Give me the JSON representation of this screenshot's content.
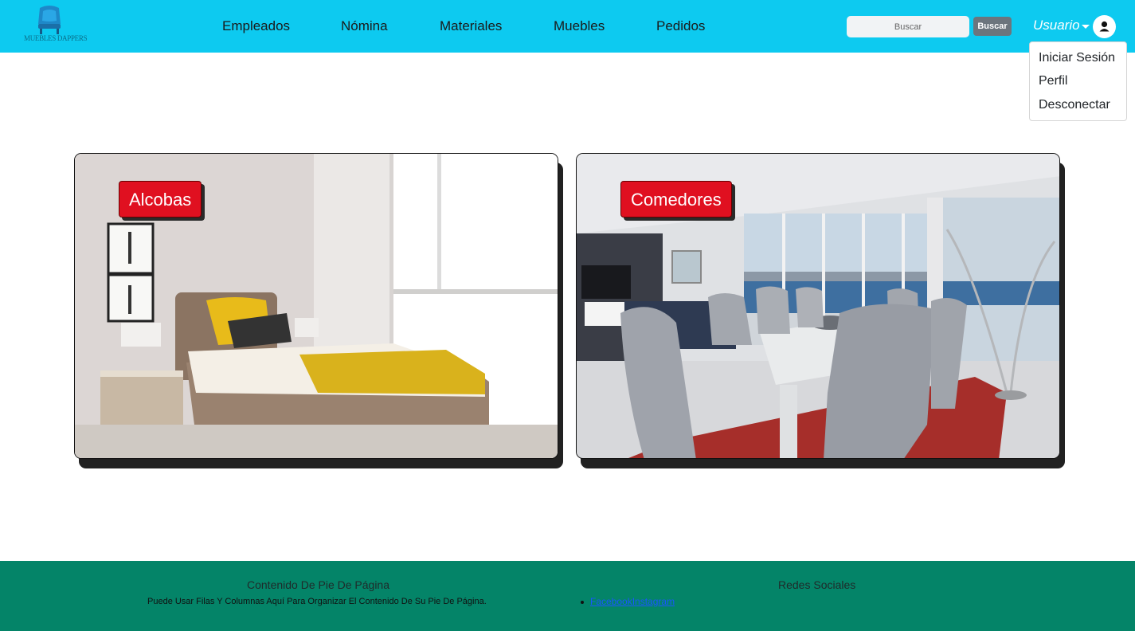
{
  "brand": {
    "logo_text": "MUEBLES DAPPERS"
  },
  "nav": {
    "items": [
      {
        "label": "Empleados"
      },
      {
        "label": "Nómina"
      },
      {
        "label": "Materiales"
      },
      {
        "label": "Muebles"
      },
      {
        "label": "Pedidos"
      }
    ]
  },
  "search": {
    "placeholder": "Buscar",
    "button_label": "Buscar"
  },
  "user_menu": {
    "toggle_label": "Usuario",
    "items": [
      {
        "label": "Iniciar Sesión"
      },
      {
        "label": "Perfil"
      },
      {
        "label": "Desconectar"
      }
    ]
  },
  "cards": [
    {
      "label": "Alcobas"
    },
    {
      "label": "Comedores"
    }
  ],
  "footer": {
    "content_title": "Contenido De Pie De Página",
    "content_text": "Puede Usar Filas Y Columnas Aquí Para Organizar El Contenido De Su Pie De Página.",
    "social_title": "Redes Sociales",
    "social_links": [
      {
        "label": "Facebook"
      },
      {
        "label": "Instagram"
      }
    ]
  },
  "colors": {
    "navbar": "#0dcaf0",
    "footer": "#048468",
    "tag": "#e01020",
    "search_button": "#6c757d"
  }
}
